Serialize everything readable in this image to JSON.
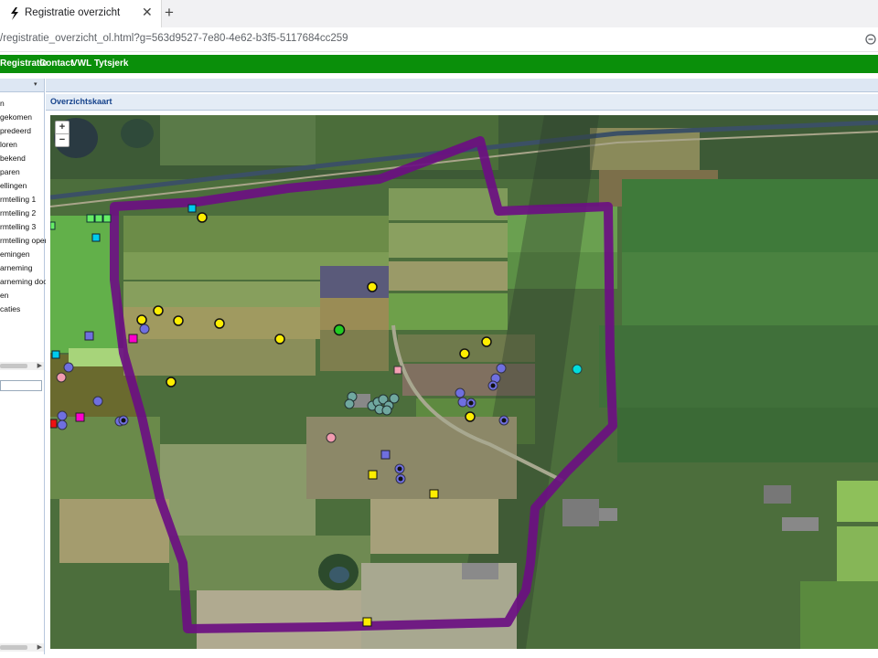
{
  "browser": {
    "tab_title": "Registratie overzicht",
    "close_glyph": "✕",
    "newtab_glyph": "+",
    "url": "/registratie_overzicht_ol.html?g=563d9527-7e80-4e62-b3f5-5117684cc259",
    "favicon": "favicon-icon",
    "extension_icon": "extension-icon"
  },
  "nav": {
    "items": [
      "Registratie",
      "Contact",
      "VWL Tytsjerk"
    ],
    "color": "#0a8f0a"
  },
  "sidebar": {
    "items": [
      "n",
      "gekomen",
      "predeerd",
      "loren",
      "bekend",
      "paren",
      "ellingen",
      "rmtelling 1",
      "rmtelling 2",
      "rmtelling 3",
      "rmtelling oper",
      "emingen",
      "arneming",
      "arneming doo",
      "en",
      "caties"
    ],
    "collapse_glyph": "▾",
    "scroll_glyph": "▶"
  },
  "main": {
    "panel_title": "Overzichtskaart",
    "zoom_in": "+",
    "zoom_out": "−"
  },
  "map": {
    "boundary_color": "#6b0f82",
    "marker_colors": {
      "yellow": "#ffee00",
      "blue": "#6f6fe0",
      "green": "#22cc22",
      "teal": "#70a8a0",
      "cyan": "#00dede",
      "pink": "#f29bb0",
      "magenta": "#ff00cc",
      "red": "#ee1111",
      "light_green": "#66ee66"
    }
  }
}
